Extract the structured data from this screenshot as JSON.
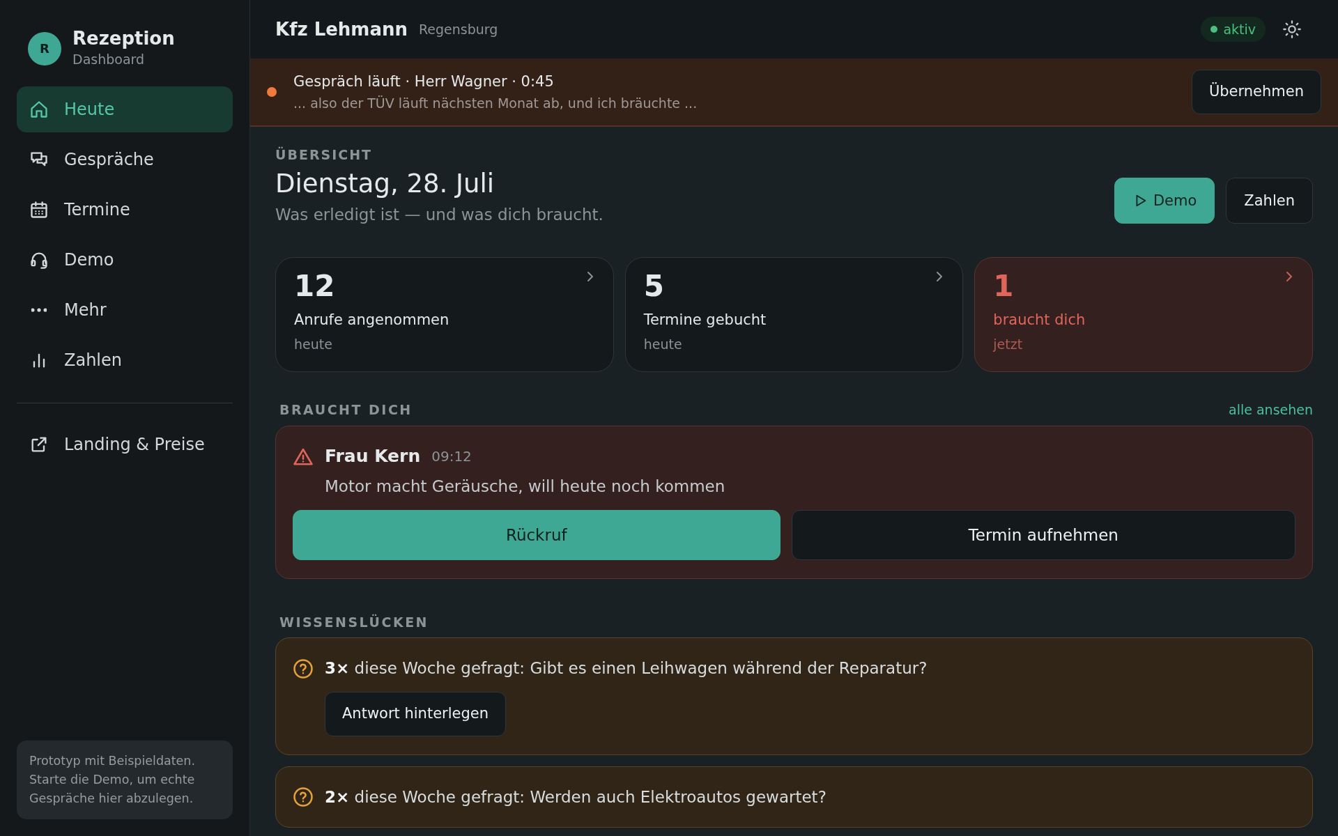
{
  "sidebar": {
    "avatar": "R",
    "title": "Rezeption",
    "subtitle": "Dashboard",
    "items": [
      {
        "label": "Heute",
        "selected": true
      },
      {
        "label": "Gespräche",
        "selected": false
      },
      {
        "label": "Termine",
        "selected": false
      },
      {
        "label": "Demo",
        "selected": false
      },
      {
        "label": "Mehr",
        "selected": false
      },
      {
        "label": "Zahlen",
        "selected": false
      }
    ],
    "footer_links": [
      {
        "label": "Landing & Preise"
      }
    ],
    "note": "Prototyp mit Beispieldaten. Starte die Demo, um echte Gespräche hier abzulegen."
  },
  "header": {
    "title": "Kfz Lehmann",
    "location": "Regensburg",
    "status": {
      "label": "aktiv",
      "on": true
    }
  },
  "live_call": {
    "title": "Gespräch läuft · Herr Wagner · 0:45",
    "transcript": "... also der TÜV läuft nächsten Monat ab, und ich bräuchte ...",
    "button": "Übernehmen"
  },
  "overview": {
    "eyebrow": "ÜBERSICHT",
    "title": "Dienstag, 28. Juli",
    "subtitle": "Was erledigt ist — und was dich braucht.",
    "buttons": [
      {
        "label": "Demo",
        "kind": "primary"
      },
      {
        "label": "Zahlen",
        "kind": "secondary"
      }
    ]
  },
  "stats": [
    {
      "value": "12",
      "label": "Anrufe angenommen",
      "period": "heute",
      "kind": "normal"
    },
    {
      "value": "5",
      "label": "Termine gebucht",
      "period": "heute",
      "kind": "normal"
    },
    {
      "value": "1",
      "label": "braucht dich",
      "period": "jetzt",
      "kind": "alert"
    }
  ],
  "needs_you": {
    "heading": "BRAUCHT DICH",
    "link": "alle ansehen",
    "items": [
      {
        "name": "Frau Kern",
        "time": "09:12",
        "message": "Motor macht Geräusche, will heute noch kommen",
        "actions": [
          {
            "label": "Rückruf",
            "kind": "primary"
          },
          {
            "label": "Termin aufnehmen",
            "kind": "secondary"
          }
        ]
      }
    ]
  },
  "knowledge_gaps": {
    "heading": "WISSENSLÜCKEN",
    "items": [
      {
        "question": "**3×** diese Woche gefragt: Gibt es einen Leihwagen während der Reparatur?",
        "button": "Antwort hinterlegen"
      },
      {
        "question": "**2×** diese Woche gefragt: Werden auch Elektroautos gewartet?"
      }
    ]
  }
}
